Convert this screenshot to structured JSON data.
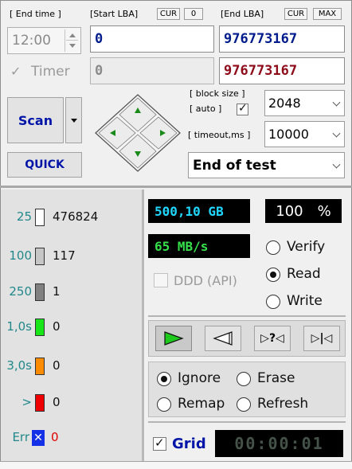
{
  "top": {
    "end_time_label": "[ End time ]",
    "end_time_value": "12:00",
    "timer_label": "Timer",
    "start_lba_label": "[Start LBA]",
    "cur_tag": "CUR",
    "zero_tag": "0",
    "start_lba_value": "0",
    "start_lba_secondary": "0",
    "end_lba_label": "[End LBA]",
    "end_cur_tag": "CUR",
    "max_tag": "MAX",
    "end_lba_value": "976773167",
    "end_lba_secondary": "976773167",
    "block_size_label": "[ block size ]",
    "auto_label": "[ auto ]",
    "block_size_value": "2048",
    "timeout_label": "[ timeout,ms ]",
    "timeout_value": "10000",
    "end_action_value": "End of test",
    "scan_label": "Scan",
    "quick_label": "QUICK"
  },
  "legend": [
    {
      "label": "25",
      "count": "476824",
      "color": "#ffffff"
    },
    {
      "label": "100",
      "count": "117",
      "color": "#c6c6c6"
    },
    {
      "label": "250",
      "count": "1",
      "color": "#808080"
    },
    {
      "label": "1,0s",
      "count": "0",
      "color": "#19e619"
    },
    {
      "label": "3,0s",
      "count": "0",
      "color": "#ff8c00"
    },
    {
      "label": ">",
      "count": "0",
      "color": "#ee0000"
    }
  ],
  "errors": {
    "label": "Err",
    "count": "0",
    "error_color": "#e00000",
    "icon_color": "#1431e8"
  },
  "status": {
    "capacity": "500,10 GB",
    "percent": "100",
    "percent_sign": "%",
    "speed": "65 MB/s",
    "ddd_label": "DDD (API)",
    "timer_display": "00:00:01",
    "progress_fraction": 1.0
  },
  "mode": {
    "verify_label": "Verify",
    "read_label": "Read",
    "write_label": "Write",
    "selected": "Read"
  },
  "error_action": {
    "ignore_label": "Ignore",
    "erase_label": "Erase",
    "remap_label": "Remap",
    "refresh_label": "Refresh",
    "selected": "Ignore"
  },
  "grid_label": "Grid",
  "transport": {
    "play_icon": "play-icon",
    "back_icon": "rewind-icon",
    "butterfly_label": "▷?◁",
    "end_label": "▷|◁"
  },
  "colors": {
    "lcd_blue": "#1fd7ff",
    "lcd_green": "#35e04a",
    "lcd_white": "#ffffff",
    "lcd_timer": "#44524a",
    "accent_blue": "#0015a8"
  }
}
